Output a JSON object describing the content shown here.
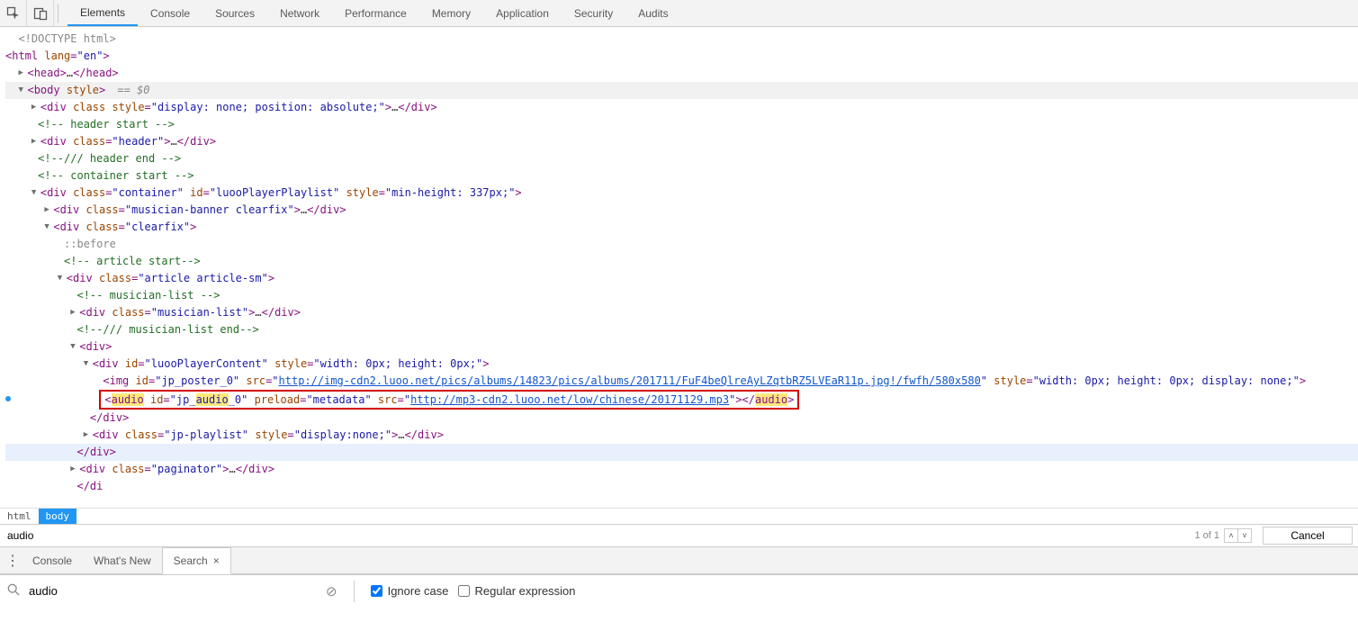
{
  "tabs": {
    "items": [
      "Elements",
      "Console",
      "Sources",
      "Network",
      "Performance",
      "Memory",
      "Application",
      "Security",
      "Audits"
    ],
    "active": 0
  },
  "dom": {
    "doctype": "<!DOCTYPE html>",
    "html_open": {
      "tag": "html",
      "attr_lang_name": "lang",
      "attr_lang_val": "\"en\""
    },
    "head": {
      "open": "head",
      "ell": "…",
      "close": "head"
    },
    "body": {
      "tag": "body",
      "style_attr": "style",
      "eq0": " == $0"
    },
    "l1": {
      "tag": "div",
      "class_name": "class",
      "style_name": "style",
      "style_val": "\"display: none; position: absolute;\"",
      "ell": "…",
      "close": "div"
    },
    "c1": "<!-- header start -->",
    "l2": {
      "tag": "div",
      "class_name": "class",
      "class_val": "\"header\"",
      "ell": "…",
      "close": "div"
    },
    "c2": "<!--/// header end -->",
    "c3": "<!-- container start -->",
    "l3": {
      "tag": "div",
      "class_name": "class",
      "class_val": "\"container\"",
      "id_name": "id",
      "id_val": "\"luooPlayerPlaylist\"",
      "style_name": "style",
      "style_val": "\"min-height: 337px;\""
    },
    "l4": {
      "tag": "div",
      "class_name": "class",
      "class_val": "\"musician-banner clearfix\"",
      "ell": "…",
      "close": "div"
    },
    "l5": {
      "tag": "div",
      "class_name": "class",
      "class_val": "\"clearfix\""
    },
    "before": "::before",
    "c4": "<!-- article start-->",
    "l6": {
      "tag": "div",
      "class_name": "class",
      "class_val": "\"article article-sm\""
    },
    "c5": "<!-- musician-list -->",
    "l7": {
      "tag": "div",
      "class_name": "class",
      "class_val": "\"musician-list\"",
      "ell": "…",
      "close": "div"
    },
    "c6": "<!--/// musician-list end-->",
    "l8": {
      "tag": "div"
    },
    "l9": {
      "tag": "div",
      "id_name": "id",
      "id_val": "\"luooPlayerContent\"",
      "style_name": "style",
      "style_val": "\"width: 0px; height: 0px;\""
    },
    "img": {
      "tag": "img",
      "id_name": "id",
      "id_val": "\"jp_poster_0\"",
      "src_name": "src",
      "src_url": "http://img-cdn2.luoo.net/pics/albums/14823/pics/albums/201711/FuF4beQlreAyLZqtbRZ5LVEaR11p.jpg!/fwfh/580x580",
      "style_name": "style",
      "style_val": "\"width: 0px; height: 0px; display: none;\""
    },
    "audio": {
      "tag": "audio",
      "id_name": "id",
      "id_pre": "\"jp_",
      "id_mid": "audio",
      "id_post": "_0\"",
      "preload_name": "preload",
      "preload_val": "\"metadata\"",
      "src_name": "src",
      "src_url": "http://mp3-cdn2.luoo.net/low/chinese/20171129.mp3"
    },
    "close_div1": "div",
    "l10": {
      "tag": "div",
      "class_name": "class",
      "class_val": "\"jp-playlist\"",
      "style_name": "style",
      "style_val": "\"display:none;\"",
      "ell": "…",
      "close": "div"
    },
    "close_div2": "div",
    "l11": {
      "tag": "div",
      "class_name": "class",
      "class_val": "\"paginator\"",
      "ell": "…",
      "close": "div"
    },
    "last_close": "</di"
  },
  "breadcrumb": {
    "html": "html",
    "body": "body"
  },
  "find": {
    "query": "audio",
    "count": "1 of 1",
    "cancel": "Cancel"
  },
  "drawer": {
    "tabs": [
      "Console",
      "What's New",
      "Search"
    ],
    "active": 2
  },
  "bottom_search": {
    "query": "audio",
    "ignore_case": "Ignore case",
    "regex": "Regular expression",
    "ignore_checked": true,
    "regex_checked": false
  }
}
